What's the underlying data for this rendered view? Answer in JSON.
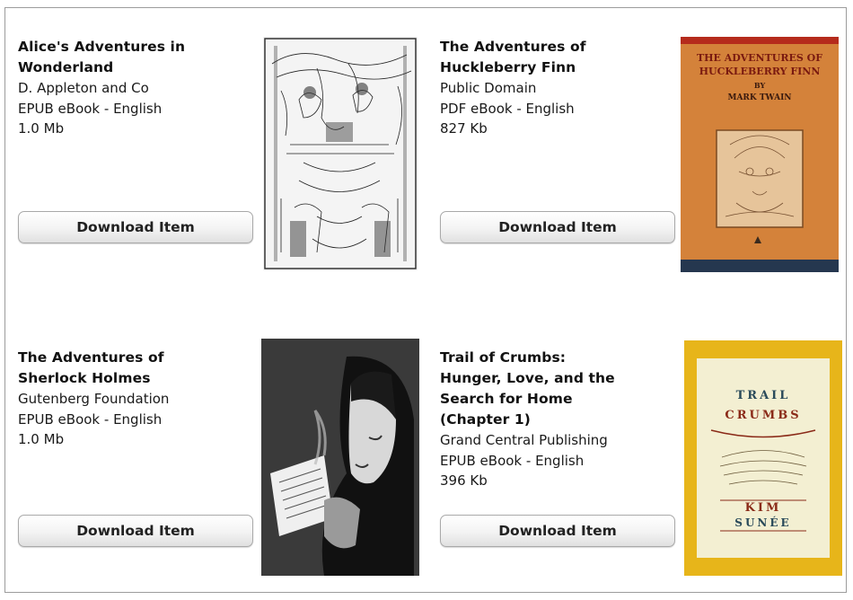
{
  "items": [
    {
      "title_lines": [
        "Alice's Adventures in",
        "Wonderland"
      ],
      "publisher": "D. Appleton and Co",
      "format": "EPUB eBook - English",
      "size": "1.0 Mb",
      "button_label": "Download Item",
      "cover_icon": "engraving-illustration-icon"
    },
    {
      "title_lines": [
        "The Adventures of",
        "Huckleberry Finn"
      ],
      "publisher": "Public Domain",
      "format": "PDF eBook - English",
      "size": "827 Kb",
      "button_label": "Download Item",
      "cover_icon": "book-cover-portrait-icon",
      "cover_text": {
        "title_line1": "THE ADVENTURES OF",
        "title_line2": "HUCKLEBERRY FINN",
        "by": "BY",
        "author": "MARK TWAIN"
      }
    },
    {
      "title_lines": [
        "The Adventures of",
        "Sherlock Holmes"
      ],
      "publisher": "Gutenberg Foundation",
      "format": "EPUB eBook - English",
      "size": "1.0 Mb",
      "button_label": "Download Item",
      "cover_icon": "detective-portrait-icon"
    },
    {
      "title_lines": [
        "Trail of Crumbs:",
        "Hunger, Love, and the",
        "Search for Home",
        "(Chapter 1)"
      ],
      "publisher": "Grand Central Publishing",
      "format": "EPUB eBook - English",
      "size": "396 Kb",
      "button_label": "Download Item",
      "cover_icon": "book-cover-typography-icon",
      "cover_text": {
        "word1": "TRAIL",
        "word2": "CRUMBS",
        "word3": "KIM",
        "word4": "SUNÉE"
      }
    }
  ]
}
